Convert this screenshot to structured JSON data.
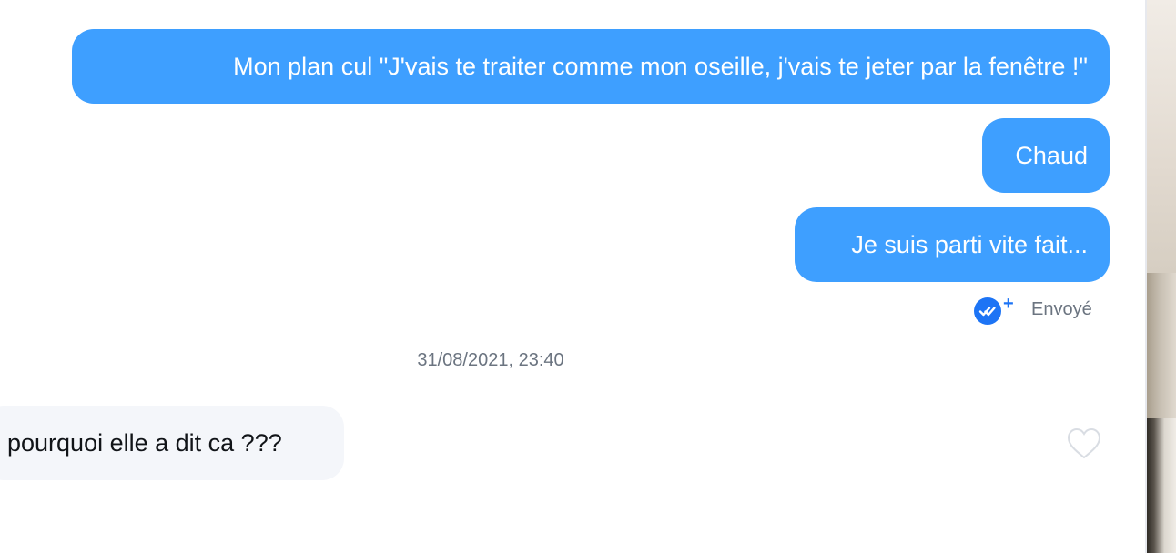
{
  "messages": [
    {
      "direction": "outgoing",
      "text": "Mon plan cul \"J'vais te traiter comme mon oseille, j'vais te jeter par la fenêtre !\""
    },
    {
      "direction": "outgoing",
      "text": "Chaud"
    },
    {
      "direction": "outgoing",
      "text": "Je suis parti vite fait..."
    },
    {
      "direction": "incoming",
      "text": "pourquoi elle a dit ca ???"
    }
  ],
  "delivery_status": {
    "label": "Envoyé",
    "icon": "double-check-icon",
    "badge": "+"
  },
  "timestamp": "31/08/2021, 23:40",
  "icons": {
    "like": "heart-outline-icon"
  },
  "colors": {
    "outgoing_bubble": "#3e9fff",
    "incoming_bubble": "#f4f6fa",
    "status_icon": "#1d74f5",
    "meta_text": "#6b7480"
  }
}
